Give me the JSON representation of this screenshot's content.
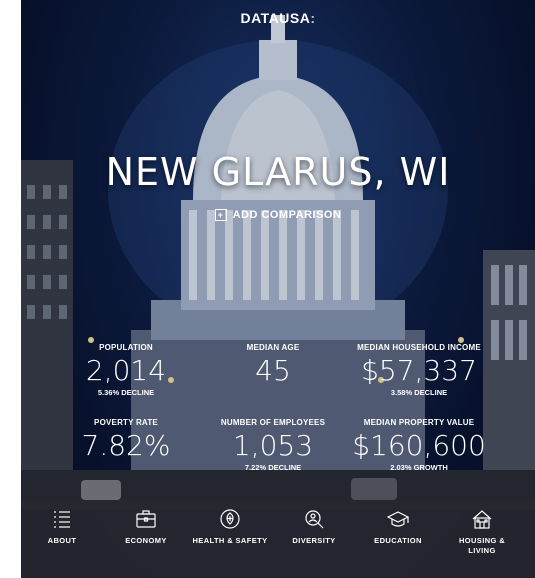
{
  "header": {
    "logo": "DATAUSA",
    "logo_mark": ":"
  },
  "place": {
    "title": "NEW GLARUS, WI",
    "comparison_label": "ADD COMPARISON"
  },
  "stats": [
    {
      "label": "POPULATION",
      "value": "2,014",
      "sub": "5.36% DECLINE"
    },
    {
      "label": "MEDIAN AGE",
      "value": "45",
      "sub": ""
    },
    {
      "label": "MEDIAN HOUSEHOLD INCOME",
      "value": "$57,337",
      "sub": "3.58% DECLINE"
    },
    {
      "label": "POVERTY RATE",
      "value": "7.82%",
      "sub": ""
    },
    {
      "label": "NUMBER OF EMPLOYEES",
      "value": "1,053",
      "sub": "7.22% DECLINE"
    },
    {
      "label": "MEDIAN PROPERTY VALUE",
      "value": "$160,600",
      "sub": "2.03% GROWTH"
    }
  ],
  "nav": [
    {
      "label": "ABOUT",
      "icon": "list-icon"
    },
    {
      "label": "ECONOMY",
      "icon": "briefcase-icon"
    },
    {
      "label": "HEALTH & SAFETY",
      "icon": "health-icon"
    },
    {
      "label": "DIVERSITY",
      "icon": "diversity-icon"
    },
    {
      "label": "EDUCATION",
      "icon": "graduation-cap-icon"
    },
    {
      "label": "HOUSING & LIVING",
      "icon": "house-icon"
    }
  ]
}
